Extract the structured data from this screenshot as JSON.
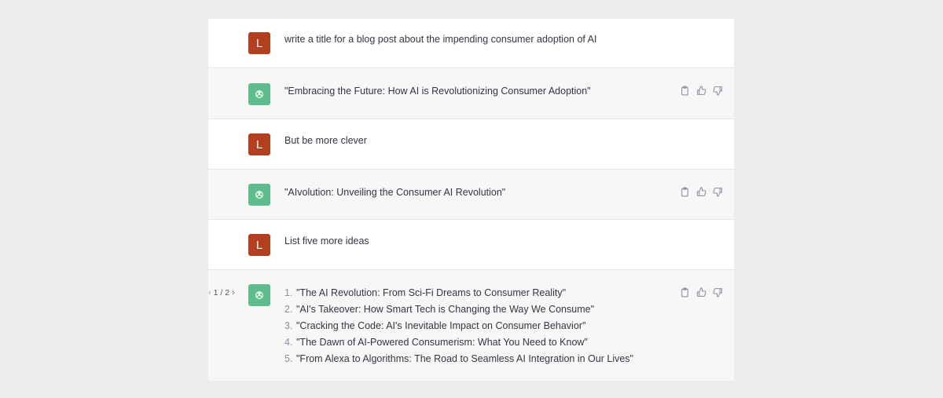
{
  "conversation": {
    "messages": [
      {
        "role": "user",
        "avatar_letter": "L",
        "text": "write a title for a blog post about the impending consumer adoption of AI"
      },
      {
        "role": "assistant",
        "avatar_icon": "openai-logo-icon",
        "text": "\"Embracing the Future: How AI is Revolutionizing Consumer Adoption\""
      },
      {
        "role": "user",
        "avatar_letter": "L",
        "text": "But be more clever"
      },
      {
        "role": "assistant",
        "avatar_icon": "openai-logo-icon",
        "text": "\"AIvolution: Unveiling the Consumer AI Revolution\""
      },
      {
        "role": "user",
        "avatar_letter": "L",
        "text": "List five more ideas"
      },
      {
        "role": "assistant",
        "avatar_icon": "openai-logo-icon",
        "pager": {
          "label": "1 / 2",
          "prev_icon": "chevron-left-icon",
          "next_icon": "chevron-right-icon"
        },
        "list": [
          {
            "n": "1.",
            "text": "\"The AI Revolution: From Sci-Fi Dreams to Consumer Reality\""
          },
          {
            "n": "2.",
            "text": "\"AI's Takeover: How Smart Tech is Changing the Way We Consume\""
          },
          {
            "n": "3.",
            "text": "\"Cracking the Code: AI's Inevitable Impact on Consumer Behavior\""
          },
          {
            "n": "4.",
            "text": "\"The Dawn of AI-Powered Consumerism: What You Need to Know\""
          },
          {
            "n": "5.",
            "text": "\"From Alexa to Algorithms: The Road to Seamless AI Integration in Our Lives\""
          }
        ]
      }
    ],
    "action_icons": [
      "clipboard-icon",
      "thumbs-up-icon",
      "thumbs-down-icon"
    ]
  },
  "colors": {
    "page_bg": "#ececec",
    "user_row_bg": "#ffffff",
    "assistant_row_bg": "#f7f7f8",
    "user_avatar": "#b2401f",
    "assistant_avatar": "#5fbc8c",
    "text": "#343541"
  }
}
